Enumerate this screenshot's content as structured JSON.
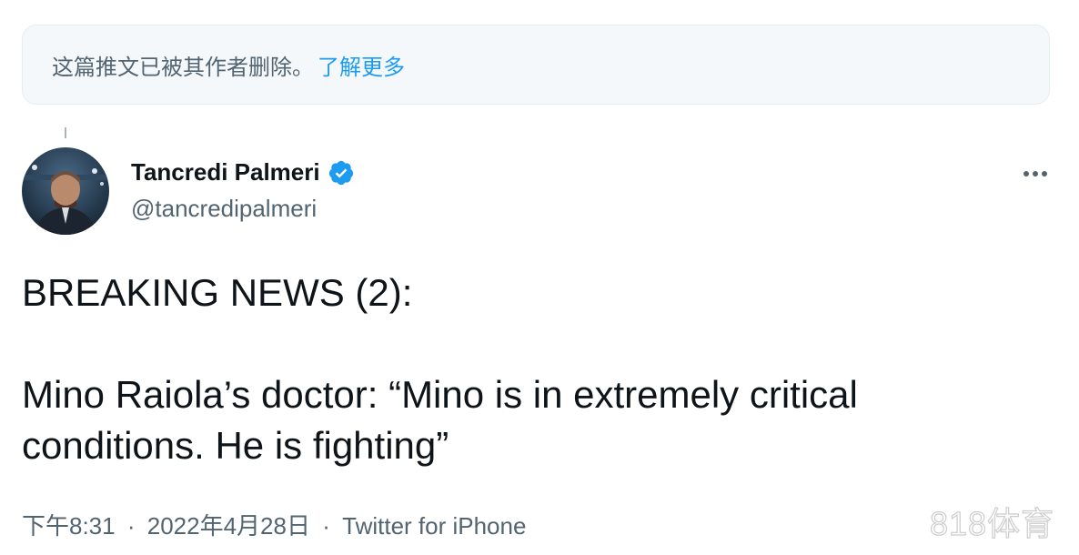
{
  "notice": {
    "text": "这篇推文已被其作者删除。",
    "link_text": "了解更多"
  },
  "author": {
    "name": "Tancredi Palmeri",
    "handle": "@tancredipalmeri",
    "verified_icon": "verified-badge-icon"
  },
  "more_icon": "more-options-icon",
  "tweet": {
    "text": "BREAKING NEWS (2):\n\nMino Raiola’s doctor: “Mino is in extremely critical\nconditions. He is fighting”"
  },
  "meta": {
    "time": "下午8:31",
    "separator": "·",
    "date": "2022年4月28日",
    "source": "Twitter for iPhone"
  },
  "watermark": "818体育",
  "colors": {
    "accent": "#1d9bf0",
    "secondary_text": "#536471",
    "primary_text": "#0f1419"
  }
}
